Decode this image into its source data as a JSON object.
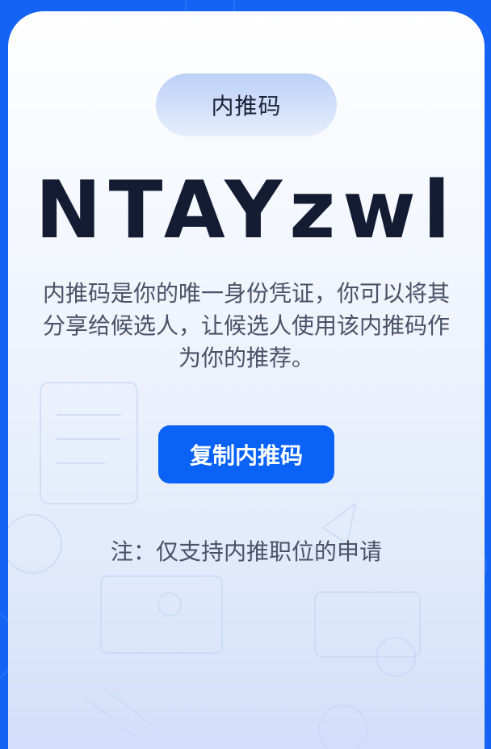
{
  "card": {
    "badge_label": "内推码",
    "referral_code": "NTAYzwl",
    "description": "内推码是你的唯一身份凭证，你可以将其分享给候选人，让候选人使用该内推码作为你的推荐。",
    "copy_button_label": "复制内推码",
    "note": "注：仅支持内推职位的申请"
  },
  "colors": {
    "page_background": "#1463f5",
    "button_background": "#0a63f6",
    "code_text": "#141c33",
    "body_text": "#4a5266"
  }
}
